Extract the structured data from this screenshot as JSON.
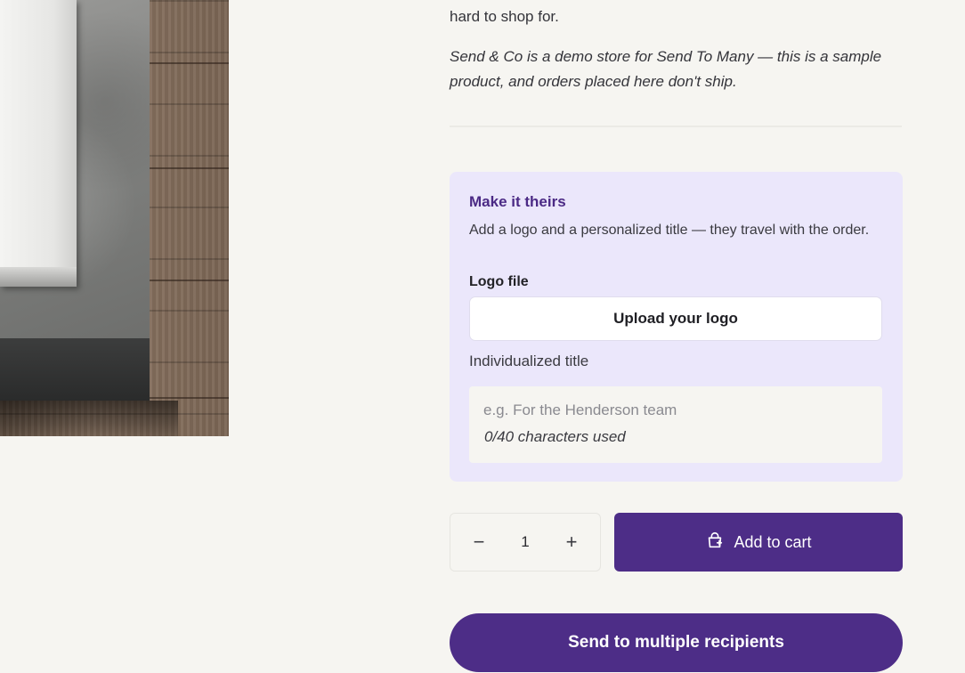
{
  "product": {
    "description_tail": "hard to shop for.",
    "demo_note": "Send & Co is a demo store for Send To Many — this is a sample product, and orders placed here don't ship."
  },
  "personalize": {
    "title": "Make it theirs",
    "description": "Add a logo and a personalized title — they travel with the order.",
    "logo_label": "Logo file",
    "upload_label": "Upload your logo",
    "title_label": "Individualized title",
    "title_placeholder": "e.g. For the Henderson team",
    "title_value": "",
    "char_count": "0/40 characters used"
  },
  "purchase": {
    "quantity": "1",
    "decrement_symbol": "−",
    "increment_symbol": "+",
    "add_to_cart_label": "Add to cart",
    "cart_icon": "cart-add-icon",
    "multi_send_label": "Send to multiple recipients"
  },
  "colors": {
    "accent": "#4d2d87",
    "panel_background": "#ebe7fb",
    "page_background": "#f6f5f1"
  }
}
